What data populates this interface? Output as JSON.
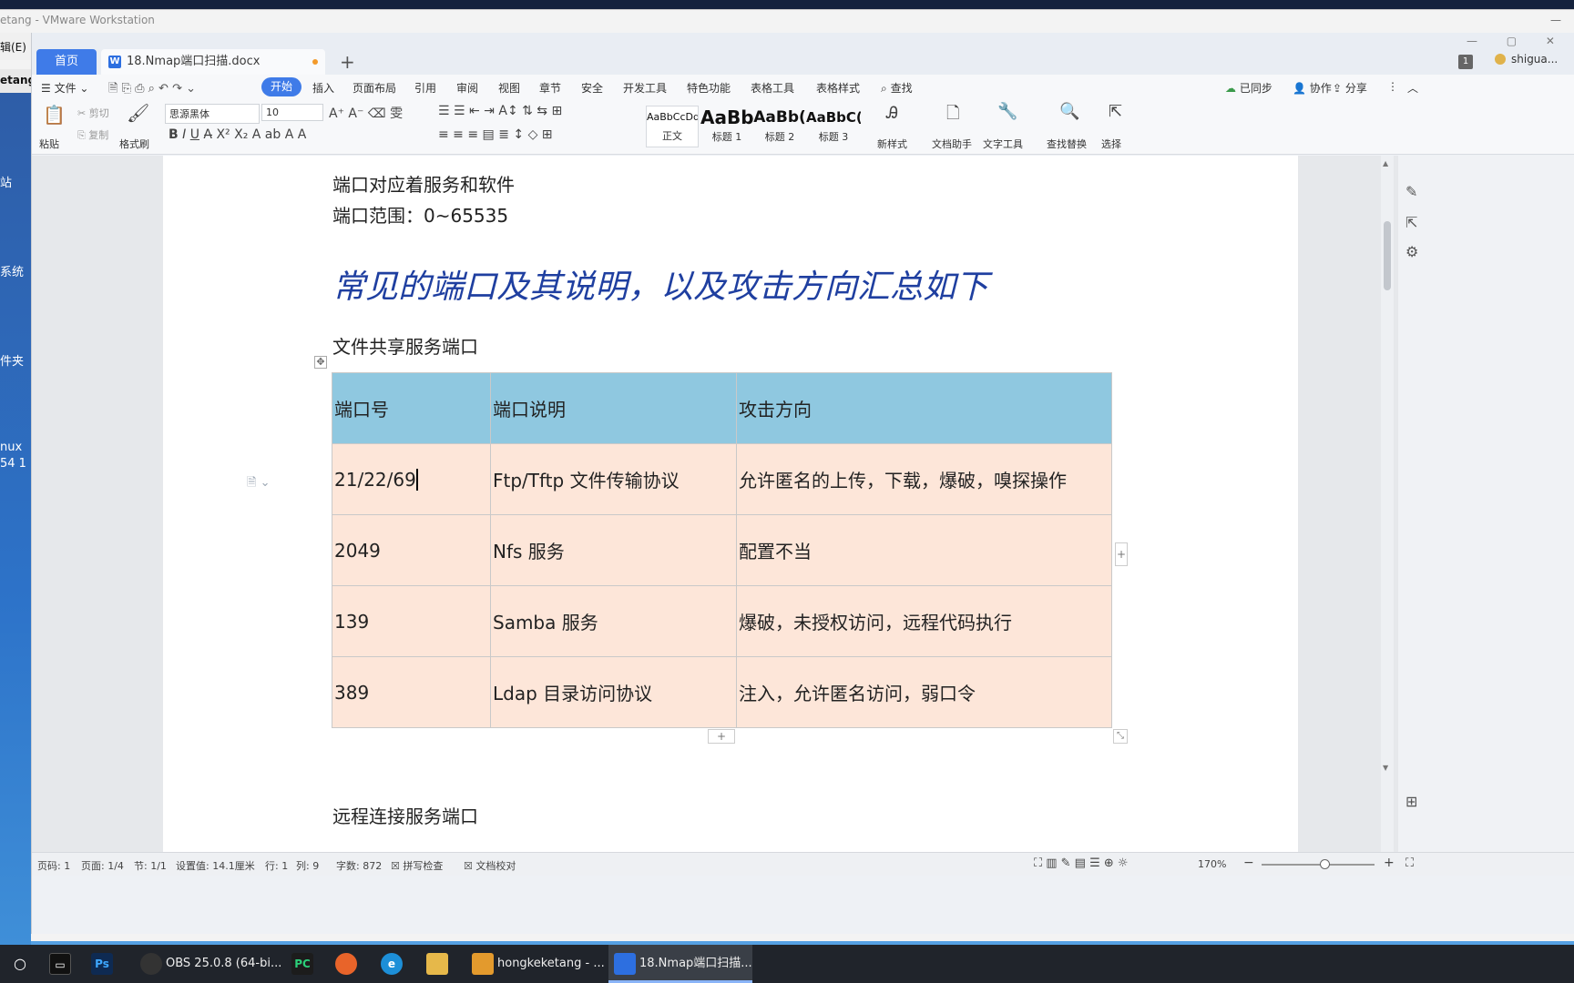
{
  "vmware": {
    "title": "etang - VMware Workstation",
    "left_menu_1": "辑(E)",
    "left_menu_2": "etang",
    "desktop_labels": [
      "站",
      "系统",
      "件夹",
      "nux",
      "54 1"
    ]
  },
  "tabs": {
    "home": "首页",
    "document": "18.Nmap端口扫描.docx",
    "add": "+",
    "badge": "1",
    "user": "shigua..."
  },
  "menu": {
    "file": "文件",
    "items": [
      "开始",
      "插入",
      "页面布局",
      "引用",
      "审阅",
      "视图",
      "章节",
      "安全",
      "开发工具",
      "特色功能",
      "表格工具",
      "表格样式"
    ],
    "search": "查找",
    "sync": "已同步",
    "collab": "协作",
    "share": "分享"
  },
  "ribbon": {
    "paste": "粘贴",
    "cut": "剪切",
    "copy": "复制",
    "format_painter": "格式刷",
    "font_name": "思源黑体",
    "font_size": "10",
    "styles": [
      {
        "preview": "AaBbCcDd",
        "name": "正文"
      },
      {
        "preview": "AaBb",
        "name": "标题 1"
      },
      {
        "preview": "AaBb(",
        "name": "标题 2"
      },
      {
        "preview": "AaBbC(",
        "name": "标题 3"
      }
    ],
    "new_style": "新样式",
    "doc_assistant": "文档助手",
    "text_tools": "文字工具",
    "find_replace": "查找替换",
    "select": "选择"
  },
  "document": {
    "line1": "端口对应着服务和软件",
    "line2": "端口范围：0~65535",
    "heading": "常见的端口及其说明，以及攻击方向汇总如下",
    "section": "文件共享服务端口",
    "table": {
      "headers": [
        "端口号",
        "端口说明",
        "攻击方向"
      ],
      "rows": [
        [
          "21/22/69",
          "Ftp/Tftp 文件传输协议",
          "允许匿名的上传，下载，爆破，嗅探操作"
        ],
        [
          "2049",
          "Nfs 服务",
          "配置不当"
        ],
        [
          "139",
          "Samba 服务",
          "爆破，未授权访问，远程代码执行"
        ],
        [
          "389",
          "Ldap 目录访问协议",
          "注入，允许匿名访问，弱口令"
        ]
      ]
    },
    "next_section": "远程连接服务端口"
  },
  "status": {
    "page_code": "页码: 1",
    "pages": "页面: 1/4",
    "section": "节: 1/1",
    "setting": "设置值: 14.1厘米",
    "row": "行: 1",
    "col": "列: 9",
    "word_count": "字数: 872",
    "spell_check": "拼写检查",
    "proofread": "文档校对",
    "zoom": "170%"
  },
  "taskbar": {
    "apps": [
      "OBS 25.0.8 (64-bi...",
      "hongkeketang - ...",
      "18.Nmap端口扫描..."
    ]
  }
}
